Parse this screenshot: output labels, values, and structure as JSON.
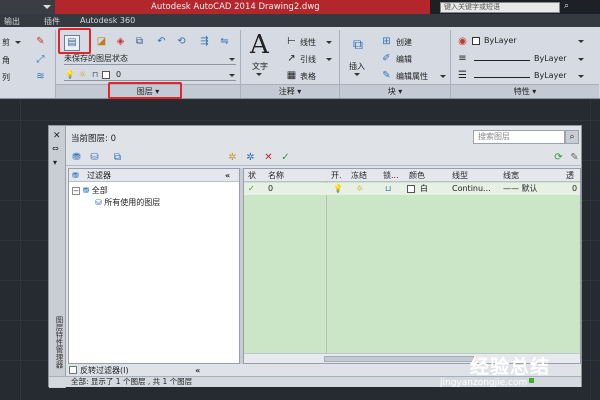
{
  "titlebar": {
    "app_title": "Autodesk AutoCAD 2014    Drawing2.dwg",
    "search_placeholder": "键入关键字或短语"
  },
  "menu_tabs": [
    "输出",
    "插件",
    "Autodesk 360"
  ],
  "ribbon": {
    "modify_labels": [
      "剪",
      "角",
      "列"
    ],
    "layer_state": "未保存的图层状态",
    "current_layer": "0",
    "layers_panel": "图层",
    "text_button": "文字",
    "annot_items": [
      "线性",
      "引线",
      "表格"
    ],
    "annotation_panel": "注释",
    "insert_button": "插入",
    "block_items": [
      "创建",
      "编辑",
      "编辑属性"
    ],
    "block_panel": "块",
    "prop_bylayer": "ByLayer",
    "properties_panel": "特性"
  },
  "palette": {
    "current_layer_label": "当前图层: 0",
    "search_placeholder": "搜索图层",
    "filters_header": "过滤器",
    "tree_all": "全部",
    "tree_used": "所有使用的图层",
    "columns": [
      "状",
      "名称",
      "开.",
      "冻结",
      "锁...",
      "颜色",
      "线型",
      "线宽",
      "透"
    ],
    "layer_row": {
      "name": "0",
      "color": "白",
      "linetype": "Continu...",
      "lineweight": "—— 默认",
      "transparency": "0"
    },
    "invert_filter": "反转过滤器(I)",
    "status": "全部: 显示了 1 个图层 , 共 1 个图层",
    "strip_label": "图层特性管理器",
    "collapse_glyph": "«"
  },
  "watermark": {
    "brand": "经验总结",
    "url": "jingyanzongjie.com"
  },
  "colors": {
    "title_red": "#b3262b",
    "list_green": "#cbe5c7",
    "highlight_red": "#e2242b"
  }
}
